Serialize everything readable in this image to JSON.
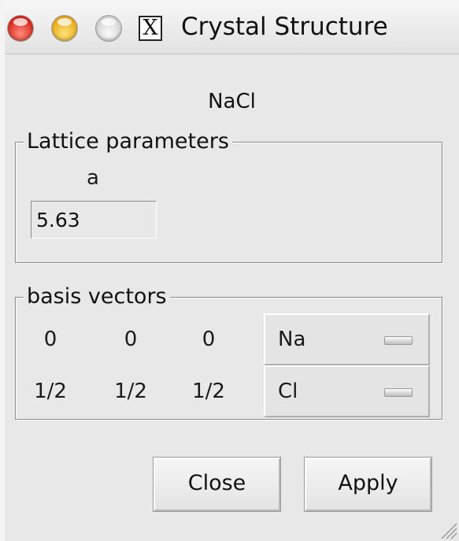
{
  "window": {
    "title": "Crystal Structure",
    "x_icon_glyph": "X"
  },
  "crystal": {
    "name": "NaCl"
  },
  "lattice": {
    "legend": "Lattice parameters",
    "param_label": "a",
    "param_value": "5.63"
  },
  "basis": {
    "legend": "basis vectors",
    "rows": [
      {
        "x": "0",
        "y": "0",
        "z": "0",
        "element": "Na"
      },
      {
        "x": "1/2",
        "y": "1/2",
        "z": "1/2",
        "element": "Cl"
      }
    ]
  },
  "buttons": {
    "close": "Close",
    "apply": "Apply"
  },
  "icons": {
    "close": "close-traffic-light-icon",
    "minimize": "minimize-traffic-light-icon",
    "zoom": "zoom-traffic-light-icon",
    "x11": "x11-icon",
    "resize": "resize-grip-icon"
  }
}
